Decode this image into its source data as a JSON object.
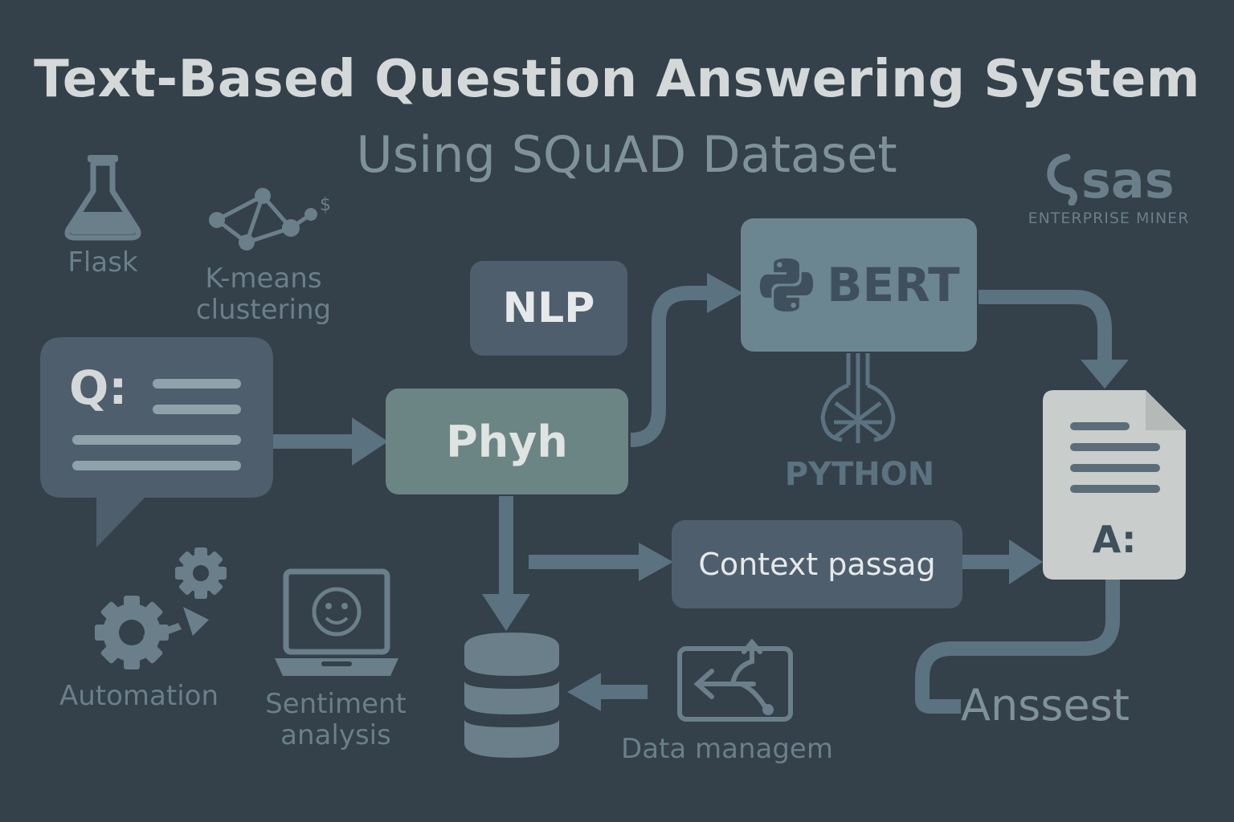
{
  "title": "Text-Based Question Answering System",
  "subtitle": "Using SQuAD Dataset",
  "logo": {
    "brand": "sas",
    "tagline": "ENTERPRISE MINER"
  },
  "icons": {
    "flask": "Flask",
    "kmeans_line1": "K-means",
    "kmeans_line2": "clustering",
    "automation": "Automation",
    "sentiment_line1": "Sentiment",
    "sentiment_line2": "analysis",
    "data_management": "Data managem"
  },
  "nodes": {
    "question": "Q:",
    "nlp": "NLP",
    "phyh": "Phyh",
    "bert": "BERT",
    "python": "PYTHON",
    "context": "Context passag",
    "answer": "A:",
    "anssest": "Anssest"
  },
  "colors": {
    "background": "#34404a",
    "title": "#d4d8d8",
    "subtitle": "#7f929a",
    "icon": "#6a7f89",
    "arrow": "#5b7280",
    "bert_box": "#6b8691",
    "phyh_box": "#6b8584",
    "nlp_box": "#4e5e6d",
    "answer_doc": "#c9cdcb"
  }
}
